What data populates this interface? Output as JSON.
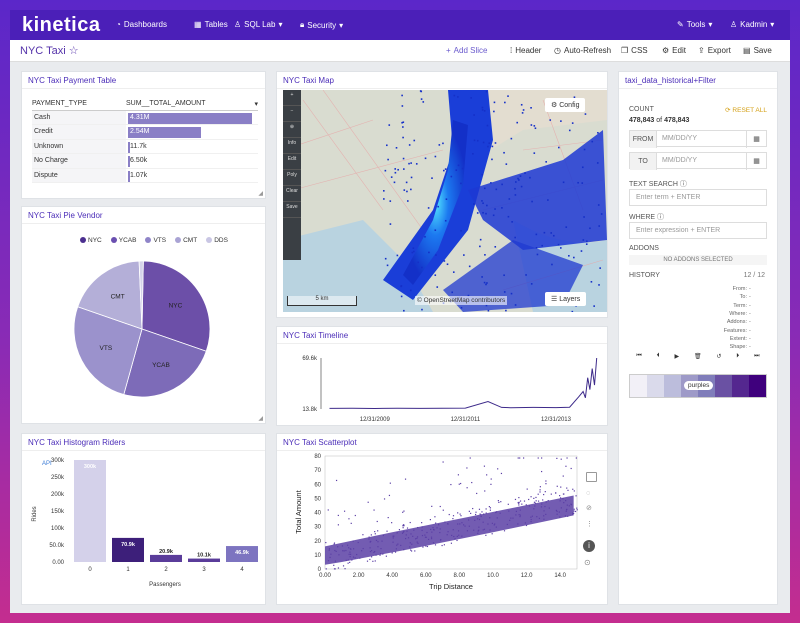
{
  "app": {
    "logo": "kinetica"
  },
  "topnav": [
    {
      "icon": "speedometer-icon",
      "label": "Dashboards",
      "caret": ""
    },
    {
      "icon": "table-icon",
      "label": "Tables",
      "caret": ""
    },
    {
      "icon": "user-icon",
      "label": "SQL Lab",
      "caret": "▾"
    },
    {
      "icon": "lock-icon",
      "label": "Security",
      "caret": "▾"
    }
  ],
  "topnav_right": [
    {
      "icon": "wrench-icon",
      "label": "Tools",
      "caret": "▾"
    },
    {
      "icon": "user-icon",
      "label": "Kadmin",
      "caret": "▾"
    }
  ],
  "subbar": {
    "title": "NYC Taxi",
    "star": "☆",
    "actions": [
      {
        "icon": "+",
        "label": "Add Slice"
      },
      {
        "icon": "⁞",
        "label": "Header"
      },
      {
        "icon": "◷",
        "label": "Auto-Refresh"
      },
      {
        "icon": "❒",
        "label": "CSS"
      },
      {
        "icon": "⚙",
        "label": "Edit"
      },
      {
        "icon": "⇪",
        "label": "Export"
      },
      {
        "icon": "▤",
        "label": "Save"
      }
    ]
  },
  "payment_table": {
    "title": "NYC Taxi Payment Table",
    "col1": "PAYMENT_TYPE",
    "col2": "SUM__TOTAL_AMOUNT",
    "sort_icon": "▾",
    "rows": [
      {
        "type": "Cash",
        "value": "4.31M",
        "fraction": 1.0
      },
      {
        "type": "Credit",
        "value": "2.54M",
        "fraction": 0.59
      },
      {
        "type": "Unknown",
        "value": "11.7k",
        "fraction": 0.003
      },
      {
        "type": "No Charge",
        "value": "6.50k",
        "fraction": 0.002
      },
      {
        "type": "Dispute",
        "value": "1.07k",
        "fraction": 0.001
      }
    ]
  },
  "pie_panel": {
    "title": "NYC Taxi Pie Vendor",
    "legend": [
      {
        "label": "NYC",
        "color": "#4b2f8f"
      },
      {
        "label": "YCAB",
        "color": "#6a4fb0"
      },
      {
        "label": "VTS",
        "color": "#8f84c8"
      },
      {
        "label": "CMT",
        "color": "#a9a3d4"
      },
      {
        "label": "DDS",
        "color": "#c9c6e4"
      }
    ]
  },
  "histogram_panel": {
    "title": "NYC Taxi Histogram Riders",
    "api_label": "API",
    "ylabel": "Rides",
    "xlabel": "Passengers"
  },
  "map_panel": {
    "title": "NYC Taxi Map",
    "config_label": "Config",
    "layers_label": "Layers",
    "scale_label": "5 km",
    "attribution": "© OpenStreetMap contributors",
    "tools": [
      "+",
      "−",
      "⊕",
      "Info",
      "Edit",
      "Poly",
      "Clear",
      "Save"
    ]
  },
  "timeline_panel": {
    "title": "NYC Taxi Timeline"
  },
  "scatter_panel": {
    "title": "NYC Taxi Scatterplot",
    "xlabel": "Trip Distance",
    "ylabel": "Total Amount"
  },
  "filter_panel": {
    "title": "taxi_data_historical+Filter",
    "count_label": "COUNT",
    "reset_label": "RESET ALL",
    "count_value": "478,843",
    "count_of": "of",
    "count_total": "478,843",
    "from_label": "FROM",
    "to_label": "TO",
    "date_placeholder": "MM/DD/YY",
    "text_search_label": "TEXT SEARCH",
    "text_search_placeholder": "Enter term + ENTER",
    "where_label": "WHERE",
    "where_placeholder": "Enter expression + ENTER",
    "addons_label": "ADDONS",
    "addons_value": "NO ADDONS SELECTED",
    "history_label": "HISTORY",
    "history_count": "12 / 12",
    "history_fields": [
      {
        "key": "From:",
        "value": "-"
      },
      {
        "key": "To:",
        "value": "-"
      },
      {
        "key": "Term:",
        "value": "-"
      },
      {
        "key": "Where:",
        "value": "-"
      },
      {
        "key": "Addons:",
        "value": "-"
      },
      {
        "key": "Features:",
        "value": "-"
      },
      {
        "key": "Extent:",
        "value": "-"
      },
      {
        "key": "Shape:",
        "value": "-"
      }
    ],
    "palette_label": "purples"
  },
  "chart_data": [
    {
      "type": "pie",
      "title": "",
      "labels": [
        "NYC",
        "YCAB",
        "VTS",
        "CMT",
        "DDS"
      ],
      "values": [
        30,
        24,
        26,
        19,
        1
      ],
      "colors": [
        "#6c4fa8",
        "#7d6bb8",
        "#9b92cc",
        "#b4afd8",
        "#d6d3ea"
      ]
    },
    {
      "type": "bar",
      "title": "",
      "categories": [
        "0",
        "1",
        "2",
        "3",
        "4"
      ],
      "values": [
        300000,
        70900,
        20900,
        10100,
        46900
      ],
      "value_labels": [
        "300k",
        "70.9k",
        "20.9k",
        "10.1k",
        "46.9k"
      ],
      "colors": [
        "#d4d1ea",
        "#3d1f7a",
        "#5a3c9a",
        "#5a3c9a",
        "#7d74c0"
      ],
      "ylim": [
        0,
        300000
      ],
      "yticks": [
        "0.00",
        "50.0k",
        "100k",
        "150k",
        "200k",
        "250k",
        "300k"
      ],
      "xlabel": "Passengers",
      "ylabel": "Rides"
    },
    {
      "type": "line",
      "title": "",
      "ytick_labels": [
        "69.6k",
        "13.8k"
      ],
      "ylim": [
        13800,
        69600
      ],
      "xtick_labels": [
        "12/31/2009",
        "12/31/2011",
        "12/31/2013"
      ],
      "x": [
        2009.0,
        2009.5,
        2010.0,
        2010.5,
        2011.0,
        2011.5,
        2012.0,
        2012.5,
        2012.8,
        2013.0,
        2013.5,
        2014.0,
        2014.3,
        2014.5,
        2014.6,
        2014.65,
        2014.7,
        2014.75,
        2014.8,
        2014.85,
        2014.9
      ],
      "y": [
        14500,
        14600,
        14400,
        14700,
        14500,
        14600,
        14800,
        22000,
        15500,
        15200,
        15600,
        15300,
        15800,
        27000,
        33000,
        26000,
        48000,
        35000,
        58000,
        40000,
        69600
      ],
      "color": "#3d2a8a"
    },
    {
      "type": "scatter",
      "title": "",
      "xlabel": "Trip Distance",
      "ylabel": "Total Amount",
      "xlim": [
        0,
        15
      ],
      "ylim": [
        0,
        80
      ],
      "xticks": [
        "0.00",
        "2.00",
        "4.00",
        "6.00",
        "8.00",
        "10.0",
        "12.0",
        "14.0"
      ],
      "yticks": [
        "0",
        "10",
        "20",
        "30",
        "40",
        "50",
        "60",
        "70",
        "80"
      ],
      "color": "#5b3fa5"
    }
  ]
}
